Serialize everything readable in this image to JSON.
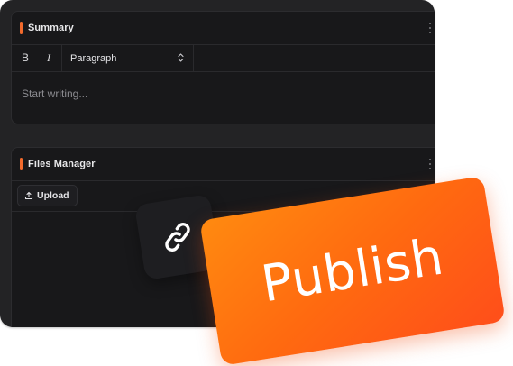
{
  "summary_panel": {
    "title": "Summary",
    "toolbar": {
      "bold_label": "B",
      "italic_label": "I",
      "format_select_value": "Paragraph"
    },
    "editor_placeholder": "Start writing..."
  },
  "files_panel": {
    "title": "Files Manager",
    "upload_label": "Upload"
  },
  "publish": {
    "label": "Publish"
  },
  "colors": {
    "accent": "#f26a2c",
    "window_bg": "#232325",
    "panel_bg": "#18181a",
    "publish_gradient_start": "#ff8a10",
    "publish_gradient_end": "#ff4e1a"
  },
  "icons": {
    "link_tile": "link-icon",
    "upload": "upload-icon",
    "drag": "drag-handle-icon",
    "select": "chevron-up-down-icon"
  }
}
